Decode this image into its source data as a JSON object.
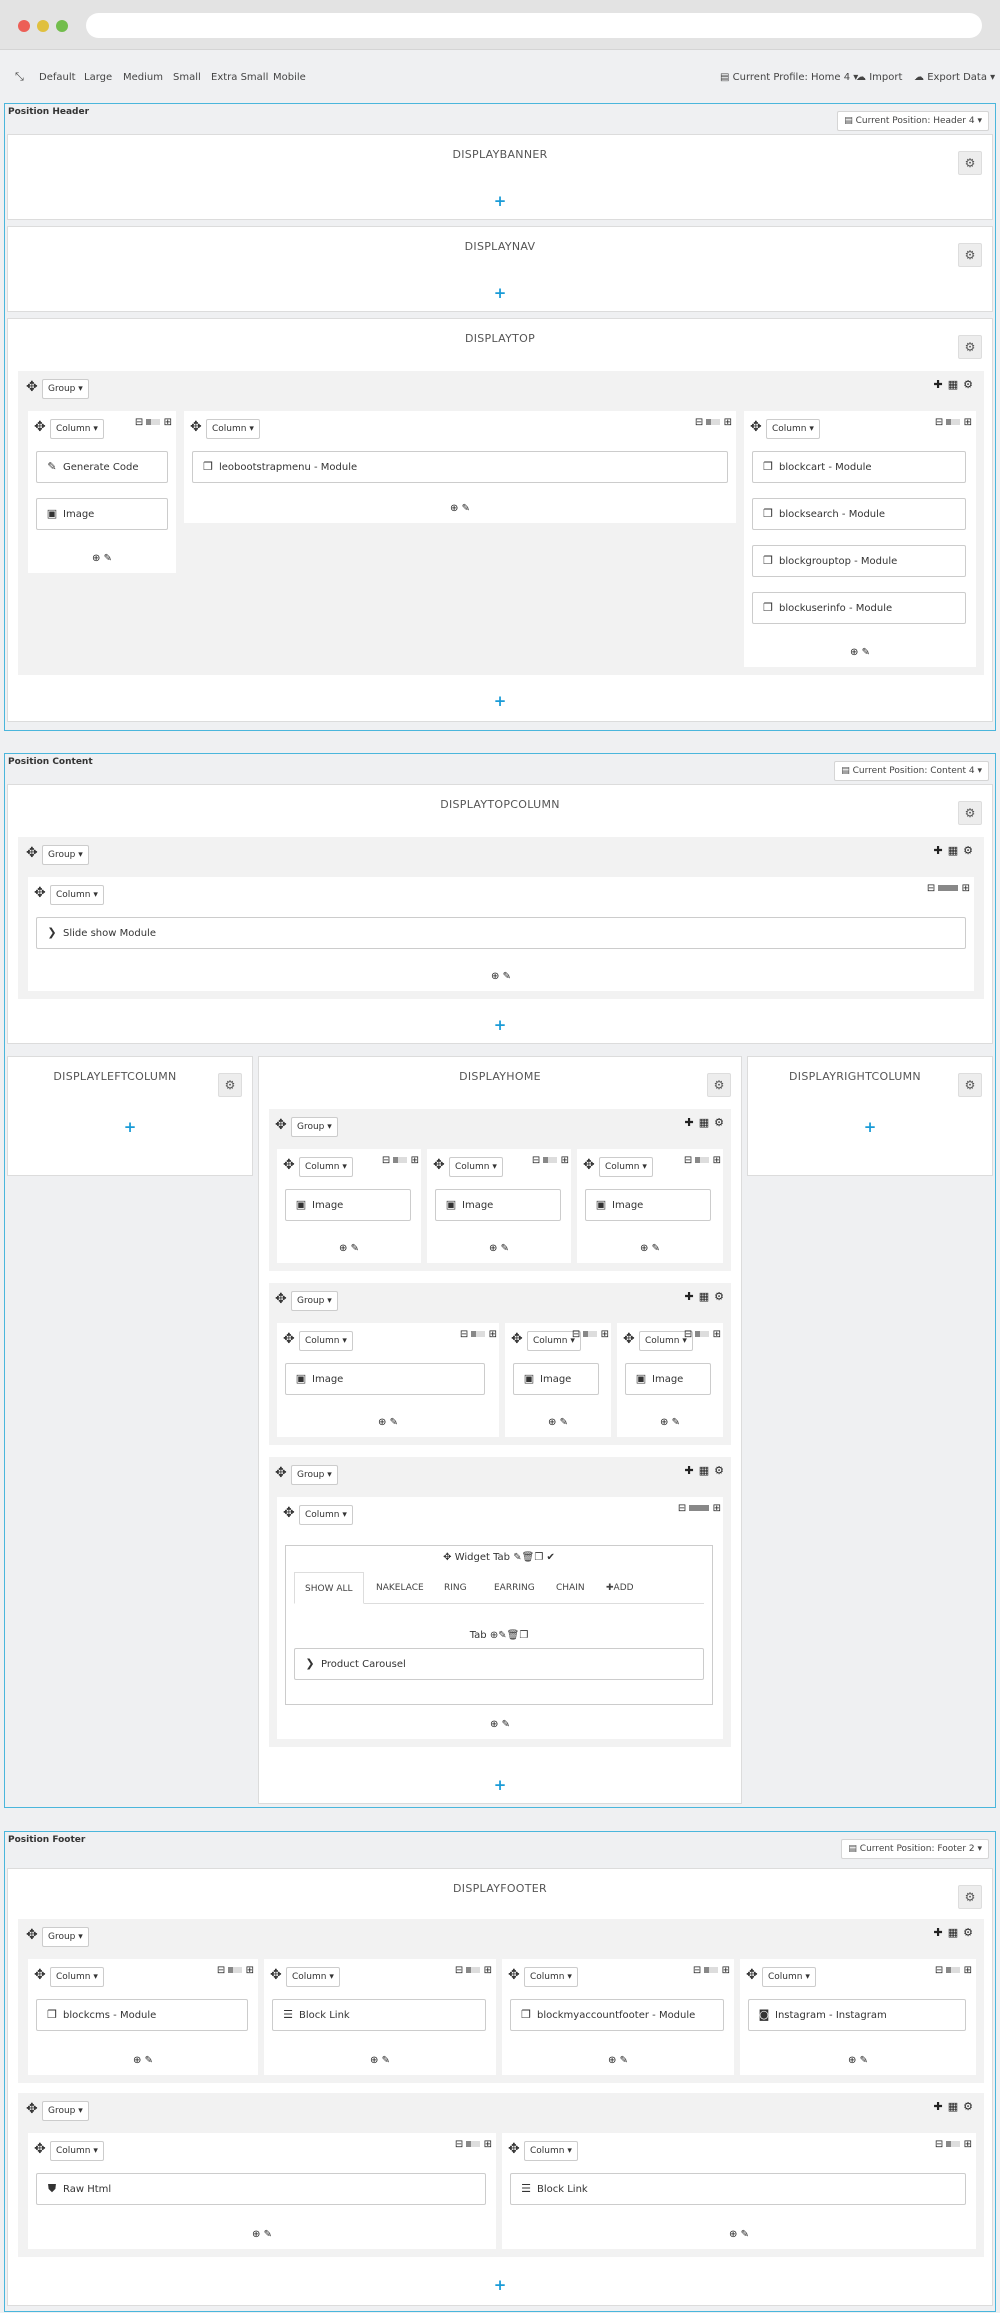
{
  "toolbar": {
    "screen_sizes": [
      "Default",
      "Large",
      "Medium",
      "Small",
      "Extra Small",
      "Mobile"
    ],
    "profile": "Current Profile: Home 4",
    "import": "Import",
    "export": "Export Data"
  },
  "header": {
    "title": "Position Header",
    "current": "Current Position: Header 4",
    "hooks": {
      "banner": "DISPLAYBANNER",
      "nav": "DISPLAYNAV",
      "top": "DISPLAYTOP"
    },
    "top_group": {
      "group_label": "Group",
      "columns": [
        {
          "label": "Column",
          "modules": [
            "Generate Code",
            "Image"
          ]
        },
        {
          "label": "Column",
          "modules": [
            "leobootstrapmenu - Module"
          ]
        },
        {
          "label": "Column",
          "modules": [
            "blockcart - Module",
            "blocksearch - Module",
            "blockgrouptop - Module",
            "blockuserinfo - Module"
          ]
        }
      ]
    }
  },
  "content": {
    "title": "Position Content",
    "current": "Current Position: Content 4",
    "topcolumn": {
      "hook": "DISPLAYTOPCOLUMN",
      "group_label": "Group",
      "column_label": "Column",
      "module": "Slide show Module"
    },
    "leftcolumn": "DISPLAYLEFTCOLUMN",
    "rightcolumn": "DISPLAYRIGHTCOLUMN",
    "home": {
      "hook": "DISPLAYHOME",
      "group_label": "Group",
      "column_label": "Column",
      "image_label": "Image",
      "widget_title": "Widget Tab",
      "tabs": [
        "SHOW ALL",
        "NAKELACE",
        "RING",
        "EARRING",
        "CHAIN",
        "ADD"
      ],
      "tab_label": "Tab",
      "carousel": "Product Carousel"
    }
  },
  "footer": {
    "title": "Position Footer",
    "current": "Current Position: Footer 2",
    "hook": "DISPLAYFOOTER",
    "group_label": "Group",
    "column_label": "Column",
    "group1_modules": [
      "blockcms - Module",
      "Block Link",
      "blockmyaccountfooter - Module",
      "Instagram - Instagram"
    ],
    "group2_modules": [
      "Raw Html",
      "Block Link"
    ]
  },
  "colors": {
    "accent": "#1a9bd7",
    "position_border": "#4ab6dc",
    "page_bg": "#eff0f2",
    "dot_red": "#ec5f57",
    "dot_yellow": "#e0c03f",
    "dot_green": "#72bd4c"
  },
  "icons": [
    "move-icon",
    "plus-icon",
    "grid-icon",
    "gear-icon",
    "pencil-icon",
    "minus-icon",
    "image-icon",
    "copy-icon",
    "edit-icon",
    "list-icon",
    "instagram-icon",
    "html5-icon",
    "chevron-right-icon",
    "trash-icon",
    "check-icon",
    "file-icon",
    "cloud-icon",
    "caret-down-icon"
  ]
}
